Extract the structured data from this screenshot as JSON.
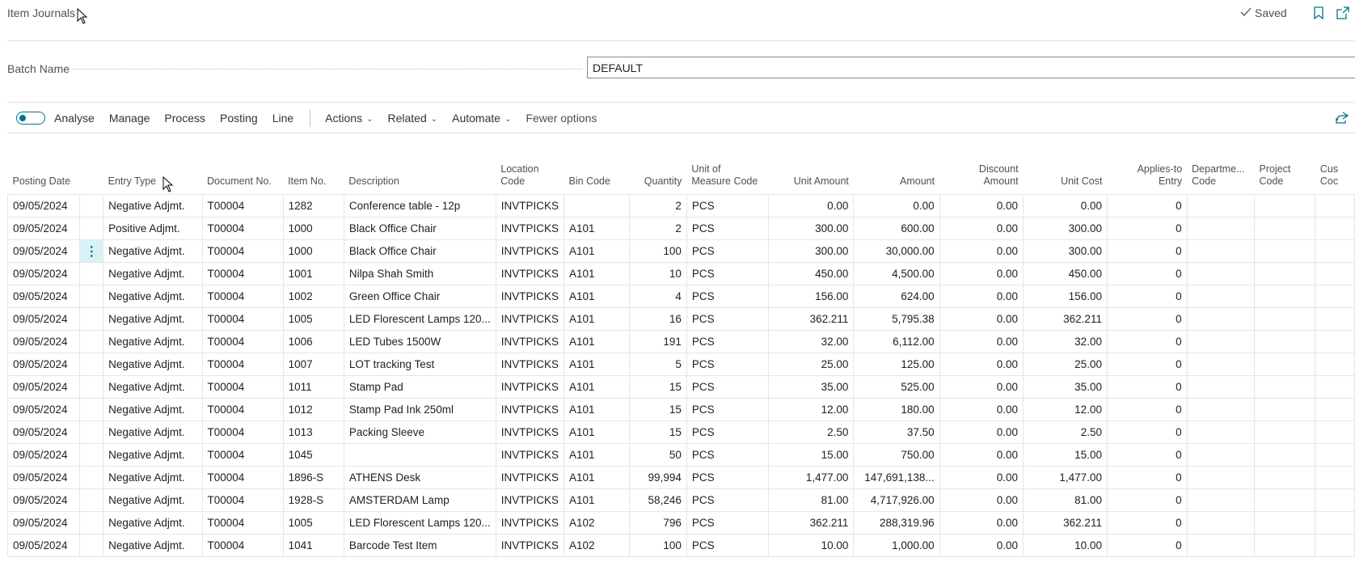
{
  "header": {
    "title": "Item Journals",
    "saved_label": "Saved",
    "bookmark_icon": "bookmark-icon",
    "open_new_icon": "open-in-new-window-icon"
  },
  "batch": {
    "label": "Batch Name",
    "value": "DEFAULT"
  },
  "toolbar": {
    "items": [
      "Analyse",
      "Manage",
      "Process",
      "Posting",
      "Line"
    ],
    "dropdowns": [
      "Actions",
      "Related",
      "Automate"
    ],
    "fewer_options": "Fewer options",
    "share_icon": "share-icon",
    "toggle_icon": "toggle-switch-icon",
    "accent_color": "#00748a"
  },
  "table": {
    "columns": [
      {
        "l1": "",
        "l2": "Posting Date",
        "align": "l"
      },
      {
        "l1": "",
        "l2": "",
        "align": "c"
      },
      {
        "l1": "",
        "l2": "Entry Type",
        "align": "l"
      },
      {
        "l1": "",
        "l2": "Document No.",
        "align": "l"
      },
      {
        "l1": "",
        "l2": "Item No.",
        "align": "l"
      },
      {
        "l1": "",
        "l2": "Description",
        "align": "l"
      },
      {
        "l1": "Location",
        "l2": "Code",
        "align": "l"
      },
      {
        "l1": "",
        "l2": "Bin Code",
        "align": "l"
      },
      {
        "l1": "",
        "l2": "Quantity",
        "align": "r"
      },
      {
        "l1": "Unit of",
        "l2": "Measure Code",
        "align": "l"
      },
      {
        "l1": "",
        "l2": "Unit Amount",
        "align": "r"
      },
      {
        "l1": "",
        "l2": "Amount",
        "align": "r"
      },
      {
        "l1": "Discount",
        "l2": "Amount",
        "align": "r"
      },
      {
        "l1": "",
        "l2": "Unit Cost",
        "align": "r"
      },
      {
        "l1": "Applies-to",
        "l2": "Entry",
        "align": "r"
      },
      {
        "l1": "Departme...",
        "l2": "Code",
        "align": "l"
      },
      {
        "l1": "Project",
        "l2": "Code",
        "align": "l"
      },
      {
        "l1": "Cus",
        "l2": "Coc",
        "align": "l"
      }
    ],
    "active_row": 2,
    "row_menu_icon": "ellipsis-vertical-icon",
    "rows": [
      [
        "09/05/2024",
        "",
        "Negative Adjmt.",
        "T00004",
        "1282",
        "Conference table - 12p",
        "INVTPICKS",
        "",
        "2",
        "PCS",
        "0.00",
        "0.00",
        "0.00",
        "0.00",
        "0",
        "",
        "",
        ""
      ],
      [
        "09/05/2024",
        "",
        "Positive Adjmt.",
        "T00004",
        "1000",
        "Black Office Chair",
        "INVTPICKS",
        "A101",
        "2",
        "PCS",
        "300.00",
        "600.00",
        "0.00",
        "300.00",
        "0",
        "",
        "",
        ""
      ],
      [
        "09/05/2024",
        "⋮",
        "Negative Adjmt.",
        "T00004",
        "1000",
        "Black Office Chair",
        "INVTPICKS",
        "A101",
        "100",
        "PCS",
        "300.00",
        "30,000.00",
        "0.00",
        "300.00",
        "0",
        "",
        "",
        ""
      ],
      [
        "09/05/2024",
        "",
        "Negative Adjmt.",
        "T00004",
        "1001",
        "Nilpa Shah Smith",
        "INVTPICKS",
        "A101",
        "10",
        "PCS",
        "450.00",
        "4,500.00",
        "0.00",
        "450.00",
        "0",
        "",
        "",
        ""
      ],
      [
        "09/05/2024",
        "",
        "Negative Adjmt.",
        "T00004",
        "1002",
        "Green Office Chair",
        "INVTPICKS",
        "A101",
        "4",
        "PCS",
        "156.00",
        "624.00",
        "0.00",
        "156.00",
        "0",
        "",
        "",
        ""
      ],
      [
        "09/05/2024",
        "",
        "Negative Adjmt.",
        "T00004",
        "1005",
        "LED Florescent Lamps 120...",
        "INVTPICKS",
        "A101",
        "16",
        "PCS",
        "362.211",
        "5,795.38",
        "0.00",
        "362.211",
        "0",
        "",
        "",
        ""
      ],
      [
        "09/05/2024",
        "",
        "Negative Adjmt.",
        "T00004",
        "1006",
        "LED Tubes 1500W",
        "INVTPICKS",
        "A101",
        "191",
        "PCS",
        "32.00",
        "6,112.00",
        "0.00",
        "32.00",
        "0",
        "",
        "",
        ""
      ],
      [
        "09/05/2024",
        "",
        "Negative Adjmt.",
        "T00004",
        "1007",
        "LOT tracking Test",
        "INVTPICKS",
        "A101",
        "5",
        "PCS",
        "25.00",
        "125.00",
        "0.00",
        "25.00",
        "0",
        "",
        "",
        ""
      ],
      [
        "09/05/2024",
        "",
        "Negative Adjmt.",
        "T00004",
        "1011",
        "Stamp Pad",
        "INVTPICKS",
        "A101",
        "15",
        "PCS",
        "35.00",
        "525.00",
        "0.00",
        "35.00",
        "0",
        "",
        "",
        ""
      ],
      [
        "09/05/2024",
        "",
        "Negative Adjmt.",
        "T00004",
        "1012",
        "Stamp Pad Ink 250ml",
        "INVTPICKS",
        "A101",
        "15",
        "PCS",
        "12.00",
        "180.00",
        "0.00",
        "12.00",
        "0",
        "",
        "",
        ""
      ],
      [
        "09/05/2024",
        "",
        "Negative Adjmt.",
        "T00004",
        "1013",
        "Packing Sleeve",
        "INVTPICKS",
        "A101",
        "15",
        "PCS",
        "2.50",
        "37.50",
        "0.00",
        "2.50",
        "0",
        "",
        "",
        ""
      ],
      [
        "09/05/2024",
        "",
        "Negative Adjmt.",
        "T00004",
        "1045",
        "",
        "INVTPICKS",
        "A101",
        "50",
        "PCS",
        "15.00",
        "750.00",
        "0.00",
        "15.00",
        "0",
        "",
        "",
        ""
      ],
      [
        "09/05/2024",
        "",
        "Negative Adjmt.",
        "T00004",
        "1896-S",
        "ATHENS Desk",
        "INVTPICKS",
        "A101",
        "99,994",
        "PCS",
        "1,477.00",
        "147,691,138...",
        "0.00",
        "1,477.00",
        "0",
        "",
        "",
        ""
      ],
      [
        "09/05/2024",
        "",
        "Negative Adjmt.",
        "T00004",
        "1928-S",
        "AMSTERDAM Lamp",
        "INVTPICKS",
        "A101",
        "58,246",
        "PCS",
        "81.00",
        "4,717,926.00",
        "0.00",
        "81.00",
        "0",
        "",
        "",
        ""
      ],
      [
        "09/05/2024",
        "",
        "Negative Adjmt.",
        "T00004",
        "1005",
        "LED Florescent Lamps 120...",
        "INVTPICKS",
        "A102",
        "796",
        "PCS",
        "362.211",
        "288,319.96",
        "0.00",
        "362.211",
        "0",
        "",
        "",
        ""
      ],
      [
        "09/05/2024",
        "",
        "Negative Adjmt.",
        "T00004",
        "1041",
        "Barcode Test Item",
        "INVTPICKS",
        "A102",
        "100",
        "PCS",
        "10.00",
        "1,000.00",
        "0.00",
        "10.00",
        "0",
        "",
        "",
        ""
      ]
    ]
  }
}
